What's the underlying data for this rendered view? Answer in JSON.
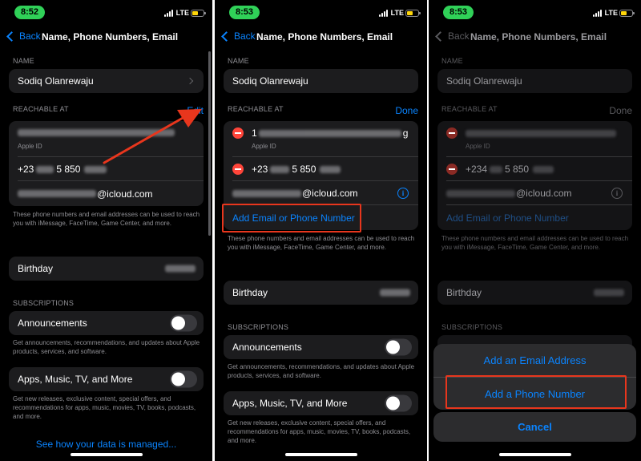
{
  "colors": {
    "accent": "#0a84ff",
    "destructive": "#ff453a",
    "annotation": "#e8361d",
    "time_pill": "#30d158",
    "battery": "#ffd60a"
  },
  "screens": [
    {
      "status": {
        "time": "8:52",
        "network": "LTE"
      },
      "nav": {
        "back_label": "Back",
        "title": "Name, Phone Numbers, Email"
      },
      "name_section": {
        "label": "NAME",
        "value": "Sodiq Olanrewaju"
      },
      "reachable": {
        "label": "REACHABLE AT",
        "action": "Edit",
        "items": [
          {
            "sub": "Apple ID"
          },
          {
            "value": "+23",
            "value_mid": "5 850"
          },
          {
            "value": "@icloud.com"
          }
        ]
      },
      "footnote": "These phone numbers and email addresses can be used to reach you with iMessage, FaceTime, Game Center, and more.",
      "birthday": "Birthday",
      "subscriptions": {
        "label": "SUBSCRIPTIONS",
        "items": [
          {
            "label": "Announcements",
            "desc": "Get announcements, recommendations, and updates about Apple products, services, and software."
          },
          {
            "label": "Apps, Music, TV, and More",
            "desc": "Get new releases, exclusive content, special offers, and recommendations for apps, music, movies, TV, books, podcasts, and more."
          }
        ]
      },
      "data_link": "See how your data is managed..."
    },
    {
      "status": {
        "time": "8:53",
        "network": "LTE"
      },
      "nav": {
        "back_label": "Back",
        "title": "Name, Phone Numbers, Email"
      },
      "name_section": {
        "label": "NAME",
        "value": "Sodiq Olanrewaju"
      },
      "reachable": {
        "label": "REACHABLE AT",
        "action": "Done",
        "items": [
          {
            "value": "1",
            "value_end": "g",
            "sub": "Apple ID"
          },
          {
            "value": "+23",
            "value_mid": "5 850"
          },
          {
            "value": "@icloud.com"
          }
        ],
        "add_label": "Add Email or Phone Number"
      },
      "footnote": "These phone numbers and email addresses can be used to reach you with iMessage, FaceTime, Game Center, and more.",
      "birthday": "Birthday",
      "subscriptions": {
        "label": "SUBSCRIPTIONS",
        "items": [
          {
            "label": "Announcements",
            "desc": "Get announcements, recommendations, and updates about Apple products, services, and software."
          },
          {
            "label": "Apps, Music, TV, and More",
            "desc": "Get new releases, exclusive content, special offers, and recommendations for apps, music, movies, TV, books, podcasts, and more."
          }
        ]
      }
    },
    {
      "status": {
        "time": "8:53",
        "network": "LTE"
      },
      "nav": {
        "back_label": "Back",
        "title": "Name, Phone Numbers, Email"
      },
      "name_section": {
        "label": "NAME",
        "value": "Sodiq Olanrewaju"
      },
      "reachable": {
        "label": "REACHABLE AT",
        "action": "Done",
        "items": [
          {
            "sub": "Apple ID"
          },
          {
            "value": "+234",
            "value_mid": "5 850"
          },
          {
            "value": "@icloud.com"
          }
        ],
        "add_label": "Add Email or Phone Number"
      },
      "footnote": "These phone numbers and email addresses can be used to reach you with iMessage, FaceTime, Game Center, and more.",
      "birthday": "Birthday",
      "subscriptions": {
        "label": "SUBSCRIPTIONS"
      },
      "sheet": {
        "add_email": "Add an Email Address",
        "add_phone": "Add a Phone Number",
        "cancel": "Cancel"
      }
    }
  ]
}
